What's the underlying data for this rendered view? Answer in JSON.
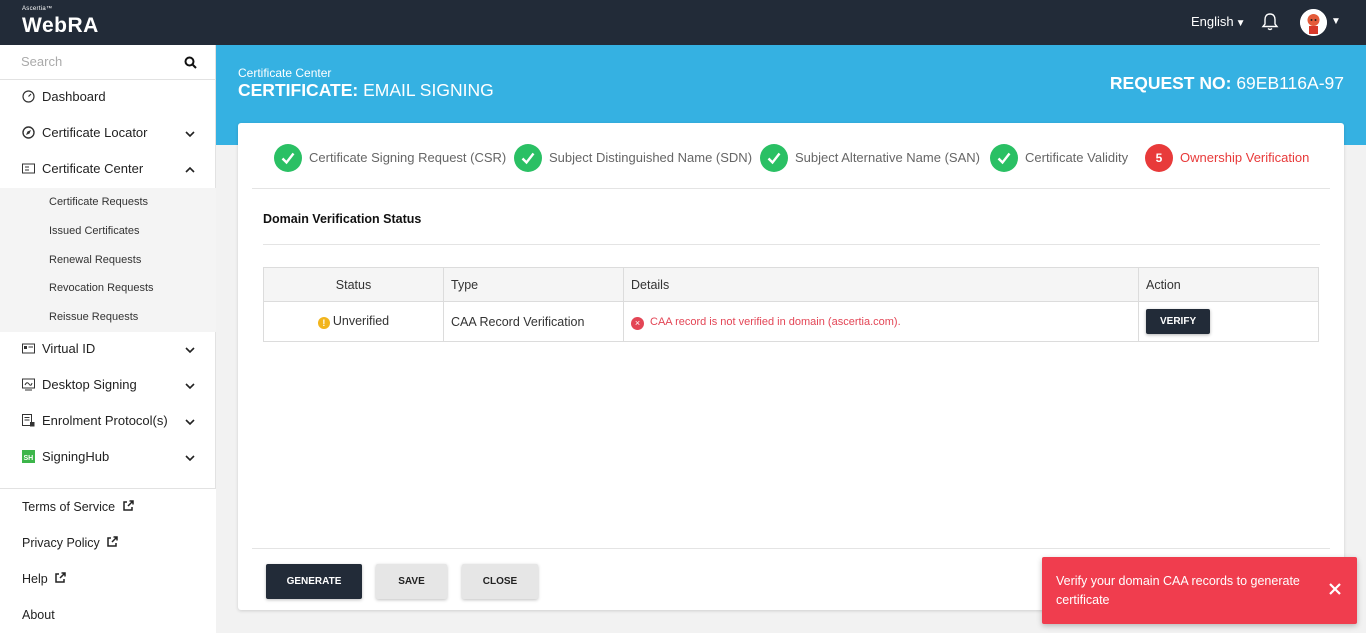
{
  "app": {
    "brand_small": "Ascertia™",
    "brand_name": "WebRA",
    "language": "English",
    "colors": {
      "topbar": "#222b38",
      "accent": "#35b1e2",
      "success": "#2ac064",
      "error": "#e83a3a",
      "warning": "#f2b51d"
    }
  },
  "sidebar": {
    "search_placeholder": "Search",
    "items": [
      {
        "label": "Dashboard",
        "icon": "dashboard-icon"
      },
      {
        "label": "Certificate Locator",
        "icon": "compass-icon"
      },
      {
        "label": "Certificate Center",
        "icon": "certificate-icon"
      },
      {
        "label": "Virtual ID",
        "icon": "id-card-icon"
      },
      {
        "label": "Desktop Signing",
        "icon": "desktop-signing-icon"
      },
      {
        "label": "Enrolment Protocol(s)",
        "icon": "protocol-icon"
      },
      {
        "label": "SigningHub",
        "icon": "signinghub-icon"
      }
    ],
    "sub_items": [
      "Certificate Requests",
      "Issued Certificates",
      "Renewal Requests",
      "Revocation Requests",
      "Reissue Requests"
    ],
    "footer": [
      "Terms of Service",
      "Privacy Policy",
      "Help",
      "About"
    ]
  },
  "header": {
    "breadcrumb": "Certificate Center",
    "title_bold": "CERTIFICATE:",
    "title_rest": " EMAIL SIGNING",
    "request_label": "REQUEST NO:",
    "request_number": " 69EB116A-97"
  },
  "steps": [
    {
      "label": "Certificate Signing Request (CSR)",
      "state": "done"
    },
    {
      "label": "Subject Distinguished Name (SDN)",
      "state": "done"
    },
    {
      "label": "Subject Alternative Name (SAN)",
      "state": "done"
    },
    {
      "label": "Certificate Validity",
      "state": "done"
    },
    {
      "label": "Ownership Verification",
      "state": "active",
      "number": "5"
    }
  ],
  "section": {
    "title": "Domain Verification Status",
    "columns": [
      "Status",
      "Type",
      "Details",
      "Action"
    ],
    "rows": [
      {
        "status_icon": "!",
        "status": "Unverified",
        "type": "CAA Record Verification",
        "details_icon": "×",
        "details": "CAA record is not verified in domain (ascertia.com).",
        "action": "VERIFY"
      }
    ]
  },
  "buttons": {
    "generate": "GENERATE",
    "save": "SAVE",
    "close": "CLOSE"
  },
  "toast": {
    "message": "Verify your domain CAA records to generate certificate"
  }
}
